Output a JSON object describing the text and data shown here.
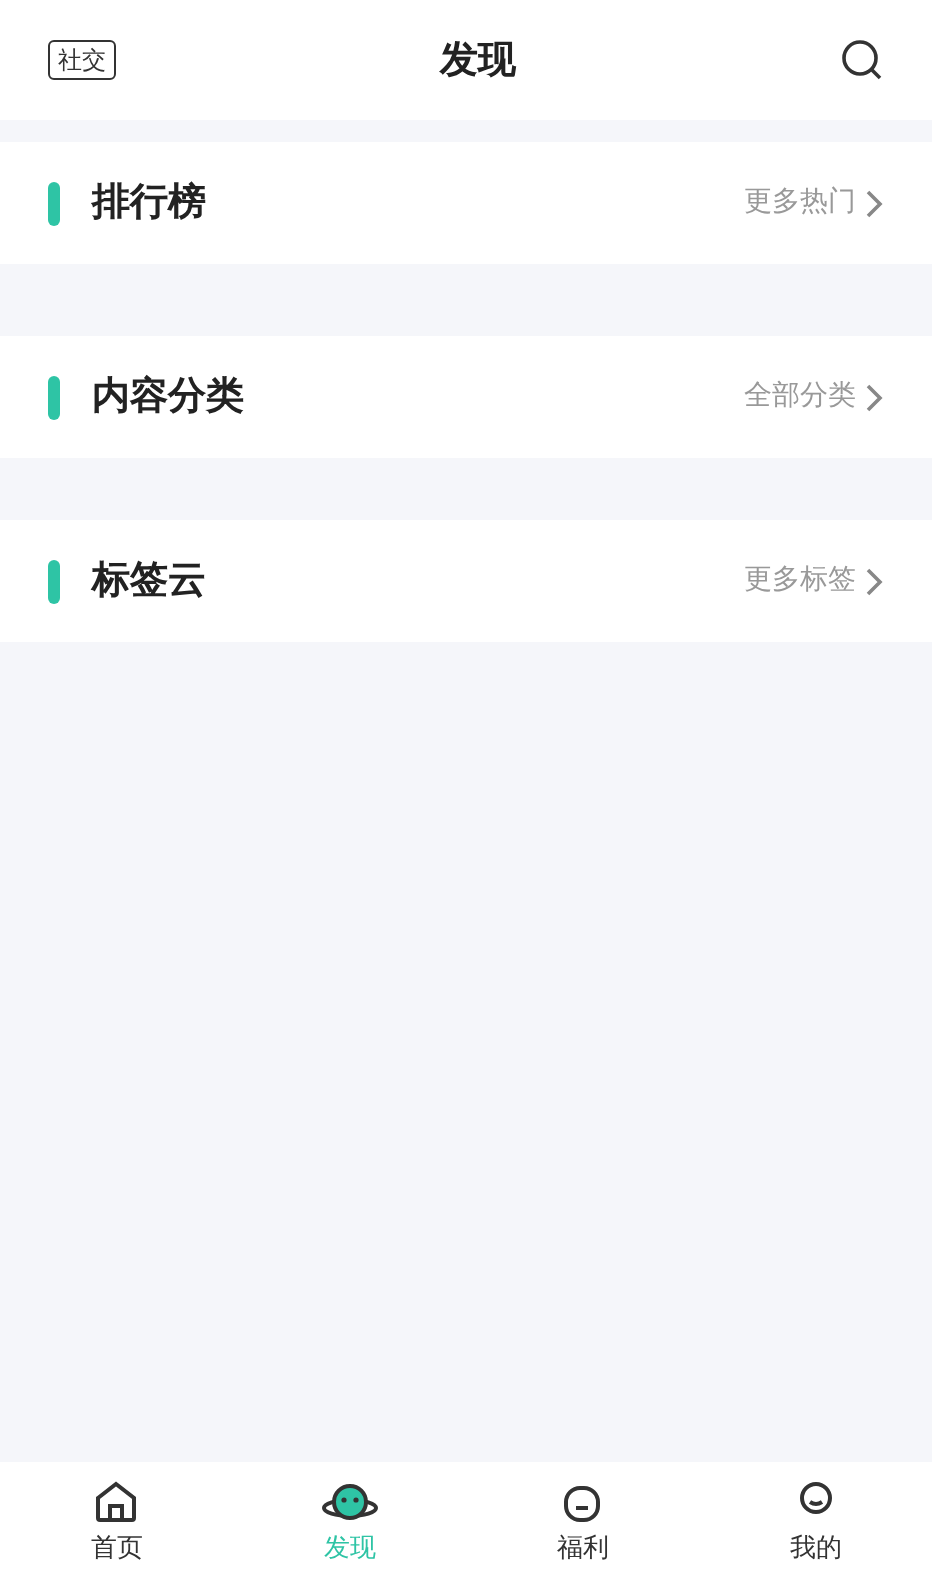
{
  "header": {
    "tag": "社交",
    "title": "发现"
  },
  "sections": [
    {
      "title": "排行榜",
      "more": "更多热门"
    },
    {
      "title": "内容分类",
      "more": "全部分类"
    },
    {
      "title": "标签云",
      "more": "更多标签"
    }
  ],
  "tabbar": [
    {
      "label": "首页",
      "kind": "home",
      "selected": false
    },
    {
      "label": "发现",
      "kind": "planet",
      "selected": true
    },
    {
      "label": "福利",
      "kind": "gift",
      "selected": false
    },
    {
      "label": "我的",
      "kind": "user",
      "selected": false
    }
  ]
}
